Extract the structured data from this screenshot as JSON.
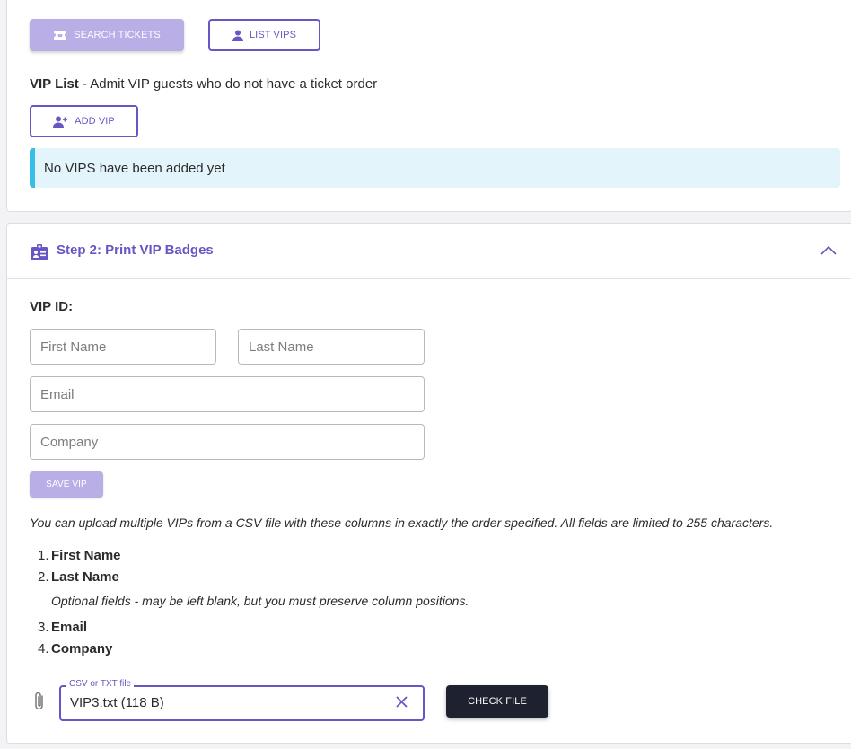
{
  "vip_lookup": {
    "search_tickets_label": "Search Tickets",
    "list_vips_label": "List VIPs",
    "vip_list_title": "VIP List",
    "vip_list_description": " - Admit VIP guests who do not have a ticket order",
    "add_vip_label": "Add VIP",
    "empty_alert": "No VIPS have been added yet"
  },
  "step2": {
    "title": "Step 2: Print VIP Badges",
    "vip_id_label": "VIP ID:",
    "first_name_placeholder": "First Name",
    "last_name_placeholder": "Last Name",
    "email_placeholder": "Email",
    "company_placeholder": "Company",
    "save_vip_label": "Save VIP",
    "upload_note": "You can upload multiple VIPs from a CSV file with these columns in exactly the order specified. All fields are limited to 255 characters.",
    "columns": [
      {
        "num": "1.",
        "name": "First Name"
      },
      {
        "num": "2.",
        "name": "Last Name"
      },
      {
        "num": "3.",
        "name": "Email"
      },
      {
        "num": "4.",
        "name": "Company"
      }
    ],
    "optional_note": "Optional fields - may be left blank, but you must preserve column positions.",
    "file_legend": "CSV or TXT file",
    "file_value": "VIP3.txt (118 B)",
    "check_file_label": "Check File"
  },
  "colors": {
    "accent": "#6a55c4",
    "accent_disabled": "#b9aee6",
    "alert_bg": "#e3f4fb",
    "alert_border": "#35bfe7",
    "dark_button": "#1e2130"
  }
}
